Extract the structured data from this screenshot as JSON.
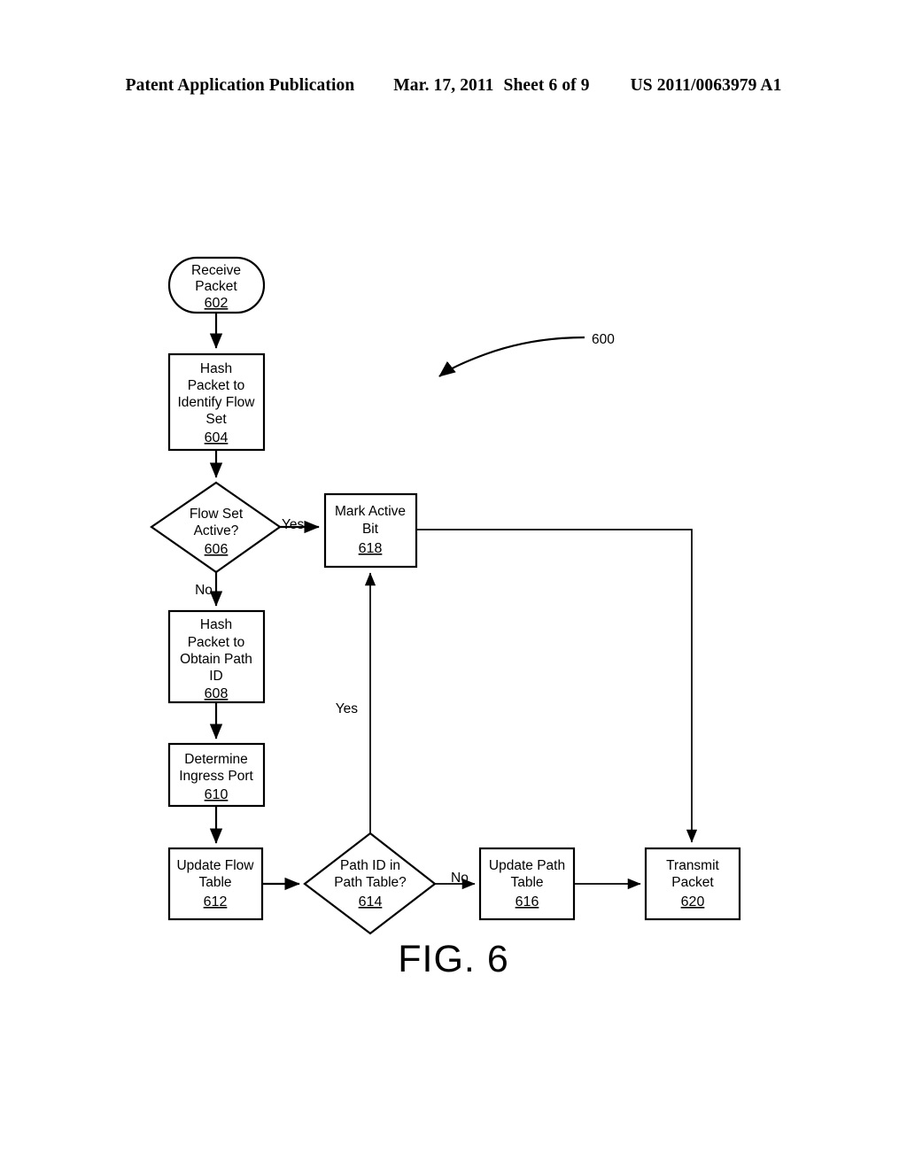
{
  "header": {
    "left": "Patent Application Publication",
    "date": "Mar. 17, 2011",
    "sheet": "Sheet 6 of 9",
    "right": "US 2011/0063979 A1"
  },
  "figure": {
    "caption": "FIG. 6",
    "diagram_ref": "600",
    "nodes": [
      {
        "id": "n602",
        "ref": "602",
        "shape": "stadium",
        "lines": [
          "Receive",
          "Packet"
        ]
      },
      {
        "id": "n604",
        "ref": "604",
        "shape": "rect",
        "lines": [
          "Hash",
          "Packet to",
          "Identify Flow",
          "Set"
        ]
      },
      {
        "id": "n606",
        "ref": "606",
        "shape": "diamond",
        "lines": [
          "Flow Set",
          "Active?"
        ]
      },
      {
        "id": "n618",
        "ref": "618",
        "shape": "rect",
        "lines": [
          "Mark Active",
          "Bit"
        ]
      },
      {
        "id": "n608",
        "ref": "608",
        "shape": "rect",
        "lines": [
          "Hash",
          "Packet to",
          "Obtain Path",
          "ID"
        ]
      },
      {
        "id": "n610",
        "ref": "610",
        "shape": "rect",
        "lines": [
          "Determine",
          "Ingress Port"
        ]
      },
      {
        "id": "n612",
        "ref": "612",
        "shape": "rect",
        "lines": [
          "Update Flow",
          "Table"
        ]
      },
      {
        "id": "n614",
        "ref": "614",
        "shape": "diamond",
        "lines": [
          "Path ID in",
          "Path Table?"
        ]
      },
      {
        "id": "n616",
        "ref": "616",
        "shape": "rect",
        "lines": [
          "Update Path",
          "Table"
        ]
      },
      {
        "id": "n620",
        "ref": "620",
        "shape": "rect",
        "lines": [
          "Transmit",
          "Packet"
        ]
      }
    ],
    "edge_labels": {
      "yes_606": "Yes",
      "no_606": "No",
      "yes_614": "Yes",
      "no_614": "No"
    }
  }
}
